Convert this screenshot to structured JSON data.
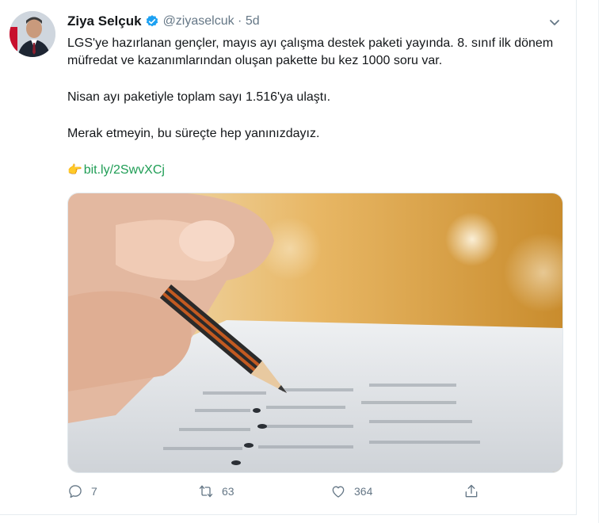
{
  "tweet": {
    "author_name": "Ziya Selçuk",
    "handle_time": "@ziyaselcuk · 5d",
    "text_line1": "LGS'ye hazırlanan gençler, mayıs ayı çalışma destek paketi yayında. 8. sınıf ilk dönem müfredat ve kazanımlarından oluşan pakette bu kez 1000 soru var.",
    "text_line2": "Nisan ayı paketiyle toplam sayı 1.516'ya ulaştı.",
    "text_line3": "Merak etmeyin, bu süreçte hep yanınızdayız.",
    "link_text": "bit.ly/2SwvXCj",
    "link_emoji": "👉",
    "media_icon": "pencil-exam-photo"
  },
  "actions": {
    "reply_count": "7",
    "retweet_count": "63",
    "like_count": "364"
  },
  "colors": {
    "verified": "#1da1f2",
    "link": "#1f9d55",
    "muted": "#657786"
  }
}
